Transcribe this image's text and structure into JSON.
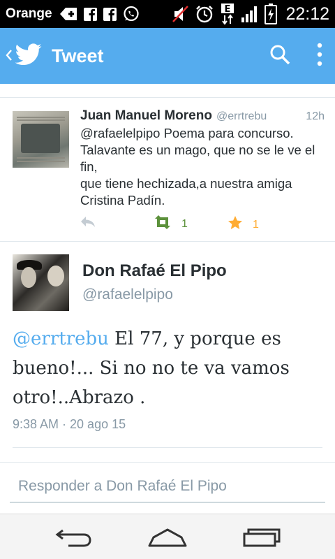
{
  "status_bar": {
    "carrier": "Orange",
    "time": "22:12",
    "icons": [
      "usb-debug-icon",
      "facebook-icon",
      "facebook-icon",
      "whatsapp-icon",
      "mute-icon",
      "alarm-icon",
      "data-e-icon",
      "signal-icon",
      "battery-charging-icon"
    ]
  },
  "action_bar": {
    "title": "Tweet",
    "icons": [
      "back-chevron-icon",
      "twitter-bird-icon",
      "search-icon",
      "overflow-menu-icon"
    ]
  },
  "reply_tweet": {
    "name": "Juan Manuel Moreno",
    "handle": "@errtrebu",
    "time": "12h",
    "text": "@rafaelelpipo Poema para concurso. Talavante es un mago, que no se le ve el fin,\nque tiene hechizada,a nuestra amiga Cristina Padín.",
    "retweet_count": "1",
    "favorite_count": "1"
  },
  "main_tweet": {
    "name": "Don Rafaé El Pipo",
    "handle": "@rafaelelpipo",
    "mention": "@errtrebu",
    "text": " El 77, y porque es bueno!... Si no no te va vamos otro!..Abrazo .",
    "timestamp": "9:38 AM · 20 ago 15"
  },
  "reply_box": {
    "placeholder": "Responder a Don Rafaé El Pipo"
  },
  "colors": {
    "accent": "#55acee",
    "retweet_green": "#5c913b",
    "favorite_orange": "#ffac33",
    "muted": "#8899a6",
    "text": "#292f33"
  }
}
